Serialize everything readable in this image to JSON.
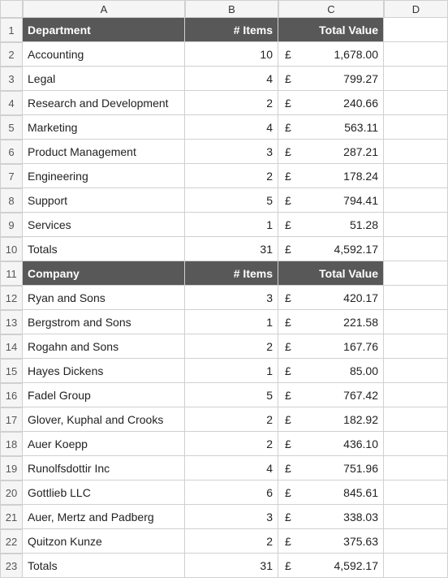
{
  "columns": [
    "A",
    "B",
    "C",
    "D"
  ],
  "rowCount": 23,
  "currencySymbol": "£",
  "section1": {
    "header": {
      "c1": "Department",
      "c2": "# Items",
      "c3": "Total Value"
    },
    "rows": [
      {
        "name": "Accounting",
        "items": "10",
        "value": "1,678.00"
      },
      {
        "name": "Legal",
        "items": "4",
        "value": "799.27"
      },
      {
        "name": "Research and Development",
        "items": "2",
        "value": "240.66"
      },
      {
        "name": "Marketing",
        "items": "4",
        "value": "563.11"
      },
      {
        "name": "Product Management",
        "items": "3",
        "value": "287.21"
      },
      {
        "name": "Engineering",
        "items": "2",
        "value": "178.24"
      },
      {
        "name": "Support",
        "items": "5",
        "value": "794.41"
      },
      {
        "name": "Services",
        "items": "1",
        "value": "51.28"
      }
    ],
    "totals": {
      "label": "Totals",
      "items": "31",
      "value": "4,592.17"
    }
  },
  "section2": {
    "header": {
      "c1": "Company",
      "c2": "# Items",
      "c3": "Total Value"
    },
    "rows": [
      {
        "name": "Ryan and Sons",
        "items": "3",
        "value": "420.17"
      },
      {
        "name": "Bergstrom and Sons",
        "items": "1",
        "value": "221.58"
      },
      {
        "name": "Rogahn and Sons",
        "items": "2",
        "value": "167.76"
      },
      {
        "name": "Hayes Dickens",
        "items": "1",
        "value": "85.00"
      },
      {
        "name": "Fadel Group",
        "items": "5",
        "value": "767.42"
      },
      {
        "name": "Glover, Kuphal and Crooks",
        "items": "2",
        "value": "182.92"
      },
      {
        "name": "Auer Koepp",
        "items": "2",
        "value": "436.10"
      },
      {
        "name": "Runolfsdottir Inc",
        "items": "4",
        "value": "751.96"
      },
      {
        "name": "Gottlieb LLC",
        "items": "6",
        "value": "845.61"
      },
      {
        "name": "Auer, Mertz and Padberg",
        "items": "3",
        "value": "338.03"
      },
      {
        "name": "Quitzon Kunze",
        "items": "2",
        "value": "375.63"
      }
    ],
    "totals": {
      "label": "Totals",
      "items": "31",
      "value": "4,592.17"
    }
  }
}
